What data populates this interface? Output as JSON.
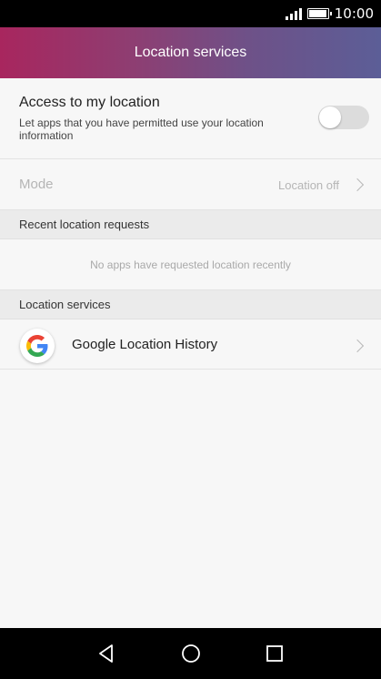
{
  "status_bar": {
    "time": "10:00",
    "signal_icon": "signal-icon",
    "battery_icon": "battery-icon"
  },
  "app_bar": {
    "title": "Location services"
  },
  "access": {
    "title": "Access to my location",
    "description": "Let apps that you have permitted use your location information",
    "toggle_on": false
  },
  "mode": {
    "label": "Mode",
    "value": "Location off",
    "chevron_icon": "chevron-right-icon"
  },
  "recent": {
    "header": "Recent location requests",
    "empty_text": "No apps have requested location recently"
  },
  "services": {
    "header": "Location services",
    "items": [
      {
        "label": "Google Location History",
        "icon": "google-icon"
      }
    ]
  },
  "nav_bar": {
    "back_icon": "back-icon",
    "home_icon": "home-icon",
    "recents_icon": "recents-icon"
  },
  "colors": {
    "app_bar_start": "#a8265e",
    "app_bar_end": "#5c5e97",
    "background": "#f7f7f7",
    "section_header": "#ebebeb"
  }
}
